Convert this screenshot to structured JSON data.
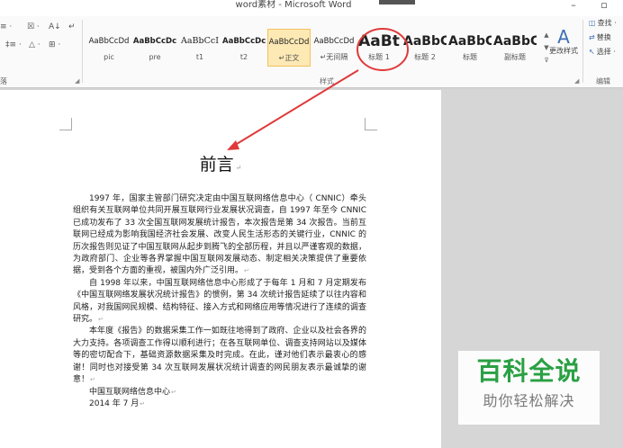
{
  "window": {
    "title": "word素材 - Microsoft Word",
    "minimize_glyph": "–",
    "restore_glyph": "▫"
  },
  "ribbon": {
    "clipboard_tools": [
      "≡ ·",
      "‡≡ ·"
    ],
    "paragraph_tools": [
      "☒ ·",
      "A↓",
      "↵",
      "≡ ·",
      "△ ·",
      "⊞ ·"
    ],
    "paragraph_group_label": "落",
    "styles_group_label": "样式",
    "editing_group_label": "编辑",
    "styles": [
      {
        "preview": "AaBbCcDd",
        "name": "pic"
      },
      {
        "preview": "AaBbCcDc",
        "name": "pre"
      },
      {
        "preview": "AaBbCcI",
        "name": "t1"
      },
      {
        "preview": "AaBbCcDc",
        "name": "t2"
      },
      {
        "preview": "AaBbCcDd",
        "name": "↵正文"
      },
      {
        "preview": "AaBbCcDd",
        "name": "↵无间隔"
      },
      {
        "preview": "AaBt",
        "name": "标题 1"
      },
      {
        "preview": "AaBbC",
        "name": "标题 2"
      },
      {
        "preview": "AaBbC",
        "name": "标题"
      },
      {
        "preview": "AaBbC",
        "name": "副标题"
      }
    ],
    "gallery_scroll": [
      "▲",
      "▼",
      "⊽"
    ],
    "change_styles_label": "更改样式",
    "change_styles_icon": "A",
    "editing": {
      "find_label": "查找 ·",
      "replace_label": "替换",
      "select_label": "选择 ·"
    }
  },
  "document": {
    "title": "前言",
    "paragraph_mark": "↵",
    "paragraphs": [
      "1997 年，国家主管部门研究决定由中国互联网络信息中心（ CNNIC）牵头组织有关互联网单位共同开展互联网行业发展状况调查，自 1997 年至今 CNNIC 已成功发布了 33 次全国互联网发展统计报告，本次报告是第 34 次报告。当前互联网已经成为影响我国经济社会发展、改变人民生活形态的关键行业，CNNIC 的历次报告则见证了中国互联网从起步到腾飞的全部历程，并且以严谨客观的数据，为政府部门、企业等各界掌握中国互联网发展动态、制定相关决策提供了重要依据，受到各个方面的重视，被国内外广泛引用。",
      "自 1998 年以来，中国互联网络信息中心形成了于每年 1 月和 7 月定期发布《中国互联网络发展状况统计报告》的惯例，第 34 次统计报告延续了以往内容和风格，对我国网民规模、结构特征、接入方式和网络应用等情况进行了连续的调查研究。",
      "本年度《报告》的数据采集工作一如既往地得到了政府、企业以及社会各界的大力支持。各项调查工作得以顺利进行；在各互联网单位、调查支持网站以及媒体等的密切配合下，基础资源数据采集及时完成。在此，谨对他们表示最衷心的感谢！同时也对接受第 34 次互联网发展状况统计调查的网民朋友表示最诚挚的谢意！"
    ],
    "signature": "中国互联网络信息中心",
    "date": "2014 年 7 月"
  },
  "watermark": {
    "line1": "百科全说",
    "line2": "助你轻松解决"
  },
  "colors": {
    "annotation": "#e03a3a",
    "accent": "#3d6fb5",
    "watermark_green": "#2aa043"
  }
}
